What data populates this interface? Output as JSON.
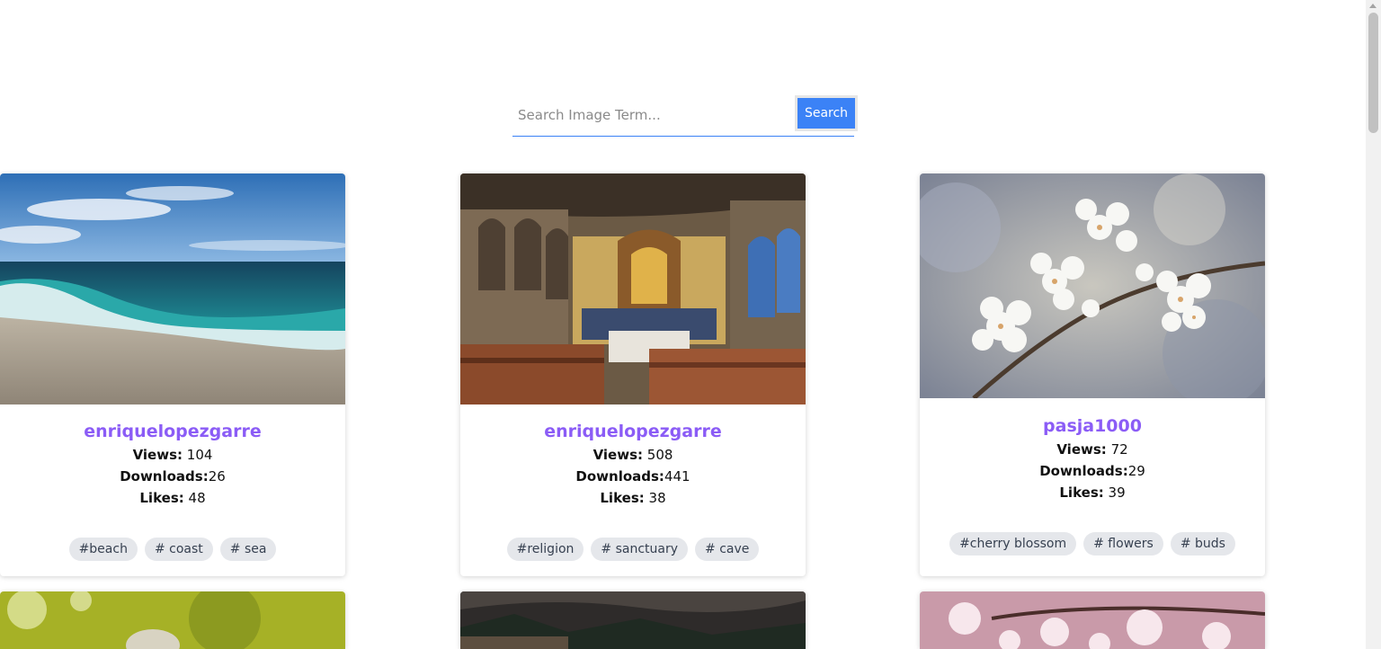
{
  "search": {
    "placeholder": "Search Image Term...",
    "button_label": "Search"
  },
  "labels": {
    "views": "Views:",
    "downloads": "Downloads:",
    "likes": "Likes:"
  },
  "cards": [
    {
      "user": "enriquelopezgarre",
      "views": "104",
      "downloads": "26",
      "likes": "48",
      "tags": [
        "#beach",
        "# coast",
        "# sea"
      ],
      "image": "beach-waves-image"
    },
    {
      "user": "enriquelopezgarre",
      "views": "508",
      "downloads": "441",
      "likes": "38",
      "tags": [
        "#religion",
        "# sanctuary",
        "# cave"
      ],
      "image": "cave-sanctuary-image"
    },
    {
      "user": "pasja1000",
      "views": "72",
      "downloads": "29",
      "likes": "39",
      "tags": [
        "#cherry blossom",
        "# flowers",
        "# buds"
      ],
      "image": "cherry-blossom-image"
    }
  ],
  "colors": {
    "accent": "#3b82f6",
    "username": "#8b5cf6",
    "tag_bg": "#e5e7eb"
  }
}
